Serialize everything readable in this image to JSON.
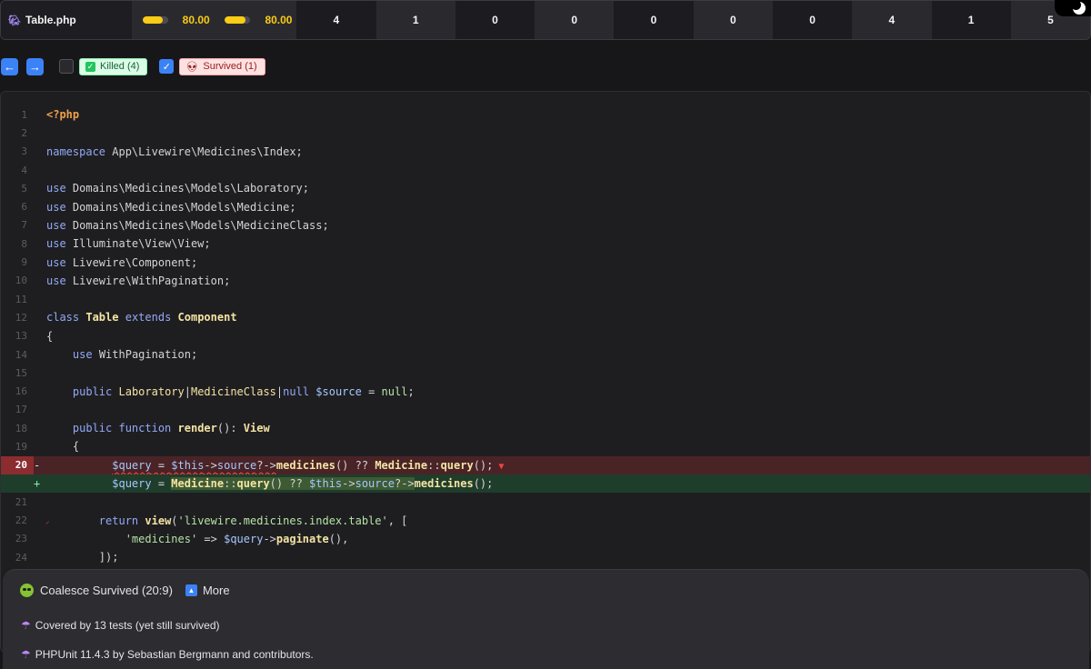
{
  "header": {
    "file_name": "Table.php",
    "file_icon": "elephant-php-icon",
    "msi": {
      "fill": 0.8,
      "label": "80.00"
    },
    "covered_msi": {
      "fill": 0.8,
      "label": "80.00"
    },
    "counts": [
      "4",
      "1",
      "0",
      "0",
      "0",
      "0",
      "0",
      "4",
      "1",
      "5"
    ]
  },
  "toolbar": {
    "prev_icon": "arrow-left-icon",
    "next_icon": "arrow-right-icon",
    "killed_label": "Killed (4)",
    "survived_label": "Survived (1)",
    "killed_checked": false,
    "survived_checked": true
  },
  "code": {
    "lines": [
      {
        "n": "1"
      },
      {
        "n": "2"
      },
      {
        "n": "3"
      },
      {
        "n": "4"
      },
      {
        "n": "5"
      },
      {
        "n": "6"
      },
      {
        "n": "7"
      },
      {
        "n": "8"
      },
      {
        "n": "9"
      },
      {
        "n": "10"
      },
      {
        "n": "11"
      },
      {
        "n": "12"
      },
      {
        "n": "13"
      },
      {
        "n": "14"
      },
      {
        "n": "15"
      },
      {
        "n": "16"
      },
      {
        "n": "17"
      },
      {
        "n": "18"
      },
      {
        "n": "19"
      },
      {
        "n": "20"
      },
      {
        "n": ""
      },
      {
        "n": "21"
      },
      {
        "n": "22"
      },
      {
        "n": "23"
      },
      {
        "n": "24"
      }
    ],
    "removed_marker": "-",
    "added_marker": "+"
  },
  "popup": {
    "title": "Coalesce Survived (20:9)",
    "more_label": "More",
    "covered_text": "Covered by 13 tests (yet still survived)",
    "footer_text": "PHPUnit 11.4.3 by Sebastian Bergmann and contributors."
  },
  "colors": {
    "accent": "#3b82f6",
    "progress": "#facc15",
    "removed": "#4a2326",
    "added": "#1f3d2b"
  }
}
